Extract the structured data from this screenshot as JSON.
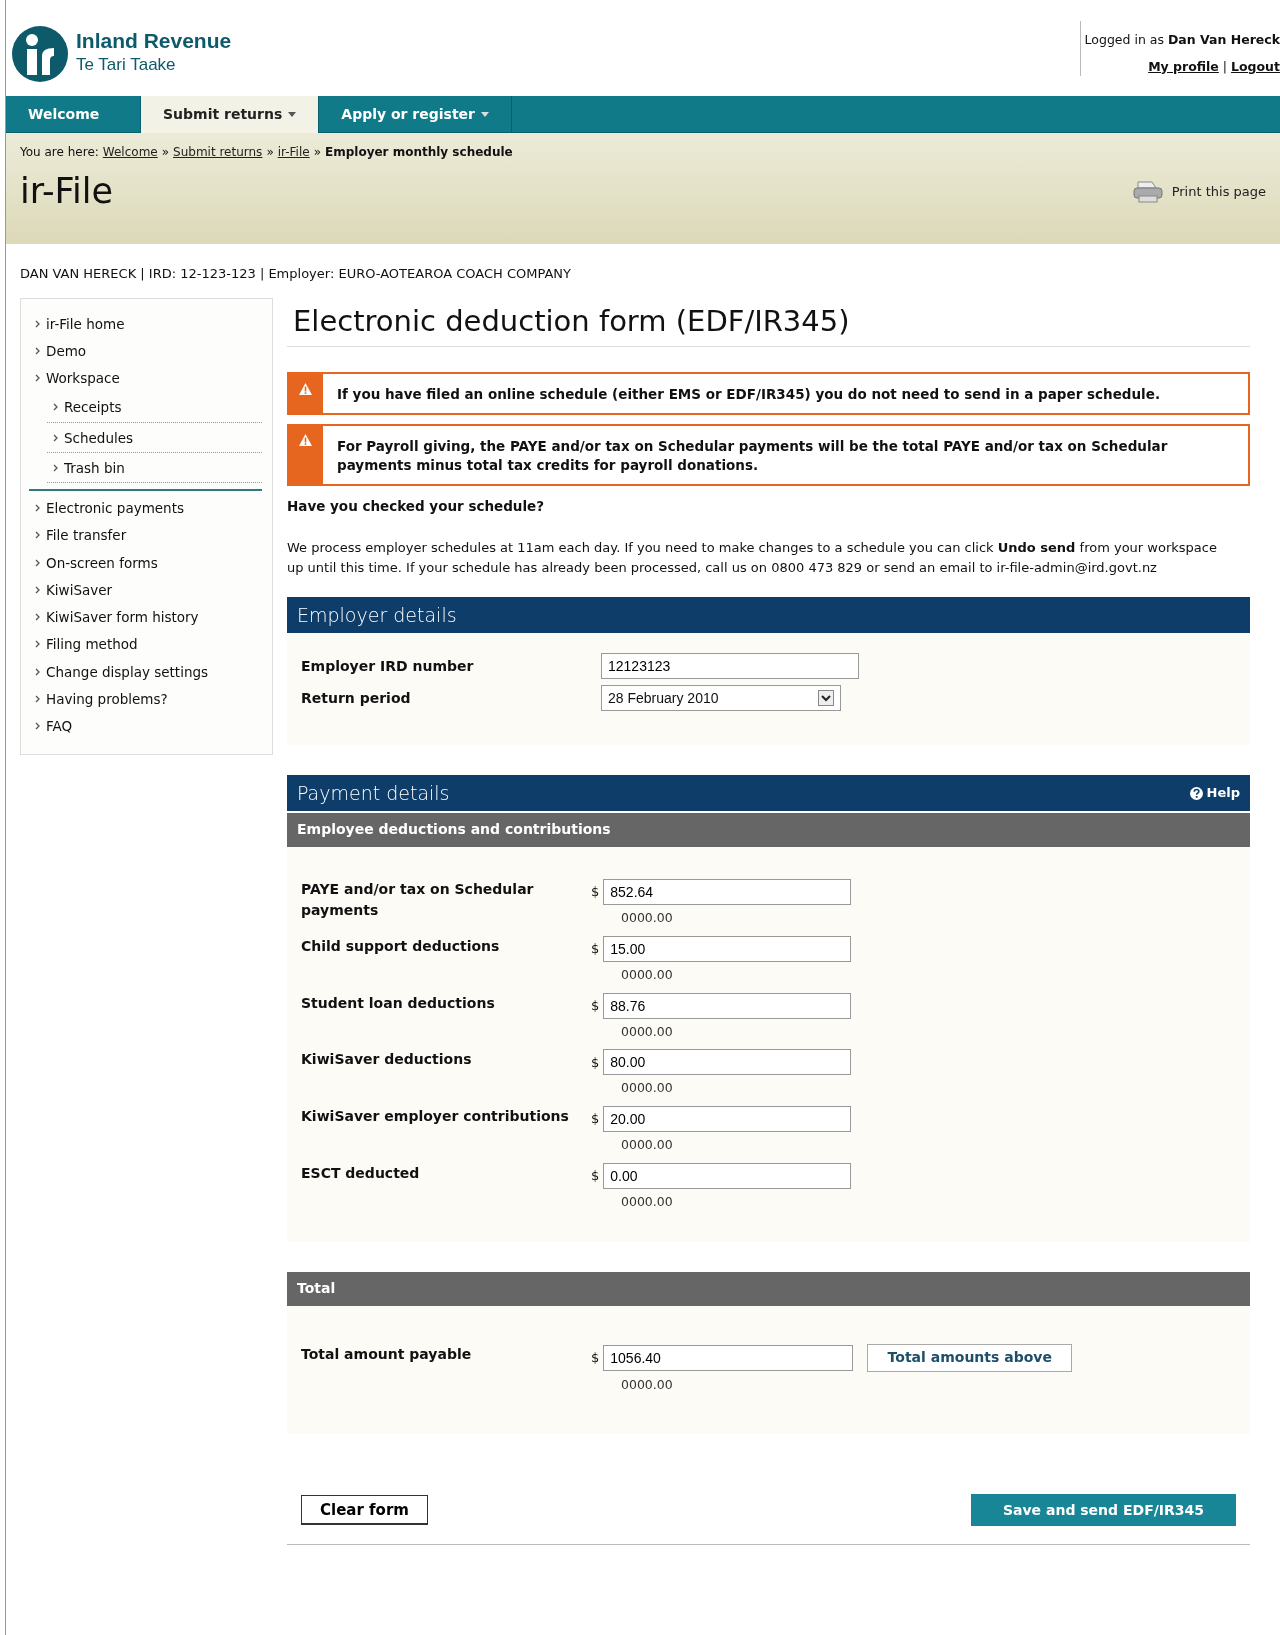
{
  "header": {
    "logo": {
      "name": "Inland Revenue",
      "subtitle": "Te Tari Taake"
    },
    "login_text": "Logged in as **Dan Van Hereck**",
    "links": [
      "My profile",
      "Logout"
    ],
    "link_separator": "|"
  },
  "nav": {
    "tabs": [
      {
        "label": "Welcome",
        "selected": false,
        "dropdown": false
      },
      {
        "label": "Submit returns",
        "selected": true,
        "dropdown": true
      },
      {
        "label": "Apply or register",
        "selected": false,
        "dropdown": true
      }
    ]
  },
  "breadcrumb": {
    "prefix": "You are here:",
    "separator": "»",
    "items": [
      {
        "label": "Welcome",
        "link": true
      },
      {
        "label": "Submit returns",
        "link": true
      },
      {
        "label": "ir-File",
        "link": true
      },
      {
        "label": "Employer monthly schedule",
        "link": false
      }
    ]
  },
  "page_title": "ir-File",
  "print_link": "Print this page",
  "identity": "DAN VAN HERECK | IRD: 12-123-123 | Employer: EURO-AOTEAROA COACH COMPANY",
  "sidebar": {
    "items": [
      {
        "label": "ir-File home"
      },
      {
        "label": "Demo"
      },
      {
        "label": "Workspace",
        "children": [
          {
            "label": "Receipts"
          },
          {
            "label": "Schedules"
          },
          {
            "label": "Trash bin"
          }
        ]
      },
      {
        "label": "Electronic payments"
      },
      {
        "label": "File transfer"
      },
      {
        "label": "On-screen forms"
      },
      {
        "label": "KiwiSaver"
      },
      {
        "label": "KiwiSaver form history"
      },
      {
        "label": "Filing method"
      },
      {
        "label": "Change display settings"
      },
      {
        "label": "Having problems?"
      },
      {
        "label": "FAQ"
      }
    ]
  },
  "form": {
    "title": "Electronic deduction form (EDF/IR345)",
    "alerts": [
      "If you have filed an online schedule (either EMS or EDF/IR345) you do not need to send in a paper schedule.",
      "For Payroll giving, the PAYE and/or tax on Schedular payments will be the total PAYE and/or tax on Schedular payments minus total tax credits for payroll donations."
    ],
    "check_heading": "Have you checked your schedule?",
    "check_text": "We process employer schedules at 11am each day. If you need to make changes to a schedule you can click **Undo send** from your workspace up until this time. If your schedule has already been processed, call us on 0800 473 829 or send an email to ir-file-admin@ird.govt.nz",
    "employer_details": {
      "title": "Employer details",
      "fields": [
        {
          "kind": "text",
          "label": "Employer IRD number",
          "value": "12123123"
        },
        {
          "kind": "select",
          "label": "Return period",
          "value": "28 February 2010"
        }
      ]
    },
    "payment_details": {
      "title": "Payment details",
      "help": "Help",
      "subtitle": "Employee deductions and contributions",
      "currency": "$",
      "rows": [
        {
          "label": "PAYE and/or tax on Schedular payments",
          "value": "852.64",
          "hint": "0000.00"
        },
        {
          "label": "Child support deductions",
          "value": "15.00",
          "hint": "0000.00"
        },
        {
          "label": "Student loan deductions",
          "value": "88.76",
          "hint": "0000.00"
        },
        {
          "label": "KiwiSaver deductions",
          "value": "80.00",
          "hint": "0000.00"
        },
        {
          "label": "KiwiSaver employer contributions",
          "value": "20.00",
          "hint": "0000.00"
        },
        {
          "label": "ESCT deducted",
          "value": "0.00",
          "hint": "0000.00"
        }
      ]
    },
    "total": {
      "title": "Total",
      "label": "Total amount payable",
      "currency": "$",
      "value": "1056.40",
      "hint": "0000.00",
      "button": "Total amounts above"
    },
    "buttons": {
      "clear": "Clear form",
      "send": "Save and send EDF/IR345"
    }
  }
}
